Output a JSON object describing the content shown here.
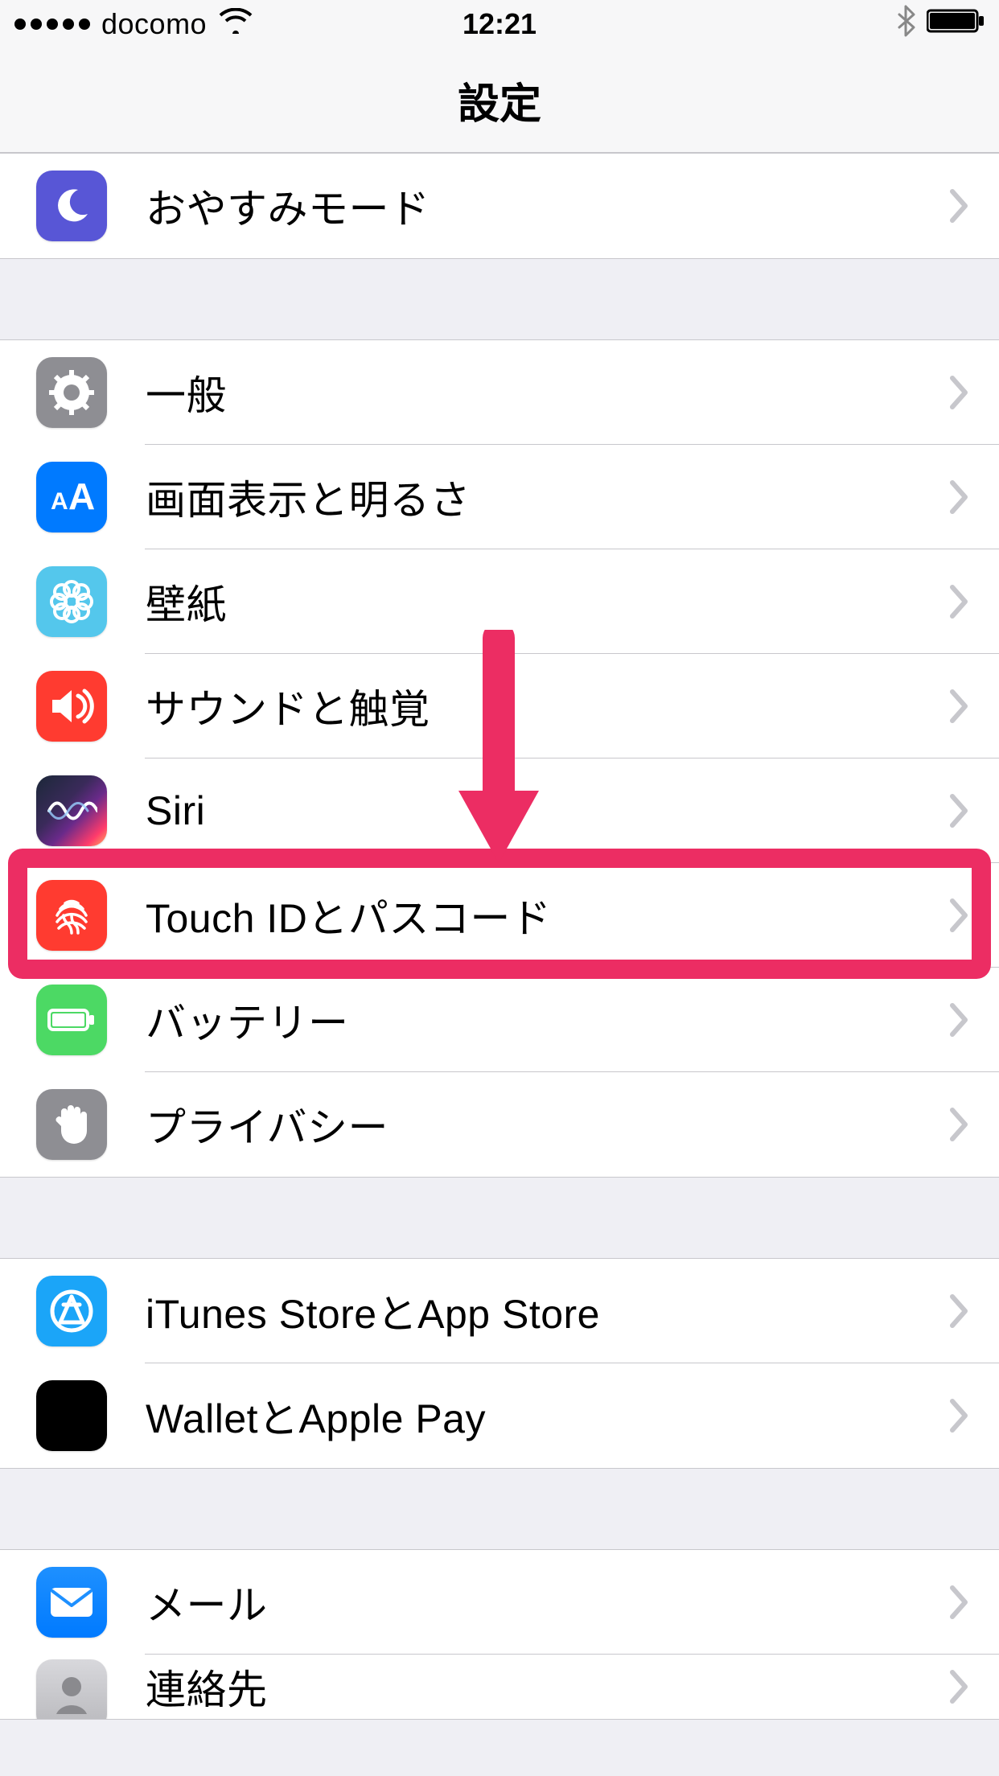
{
  "status": {
    "carrier": "docomo",
    "time": "12:21"
  },
  "nav": {
    "title": "設定"
  },
  "group_dnd": {
    "dnd": {
      "label": "おやすみモード",
      "icon": "moon-icon"
    }
  },
  "group_general": {
    "general": {
      "label": "一般",
      "icon": "gear-icon"
    },
    "display": {
      "label": "画面表示と明るさ",
      "icon": "text-size-icon"
    },
    "wallpaper": {
      "label": "壁紙",
      "icon": "flower-icon"
    },
    "sound": {
      "label": "サウンドと触覚",
      "icon": "speaker-icon"
    },
    "siri": {
      "label": "Siri",
      "icon": "siri-icon"
    },
    "touchid": {
      "label": "Touch IDとパスコード",
      "icon": "fingerprint-icon"
    },
    "battery": {
      "label": "バッテリー",
      "icon": "battery-icon"
    },
    "privacy": {
      "label": "プライバシー",
      "icon": "hand-icon"
    }
  },
  "group_store": {
    "itunes": {
      "label": "iTunes StoreとApp Store",
      "icon": "appstore-icon"
    },
    "wallet": {
      "label": "WalletとApple Pay",
      "icon": "wallet-icon"
    }
  },
  "group_mail": {
    "mail": {
      "label": "メール",
      "icon": "mail-icon"
    },
    "contacts": {
      "label": "連絡先",
      "icon": "contacts-icon"
    }
  },
  "annotation": {
    "arrow_color": "#ec2d63",
    "highlight_color": "#ec2d63"
  }
}
